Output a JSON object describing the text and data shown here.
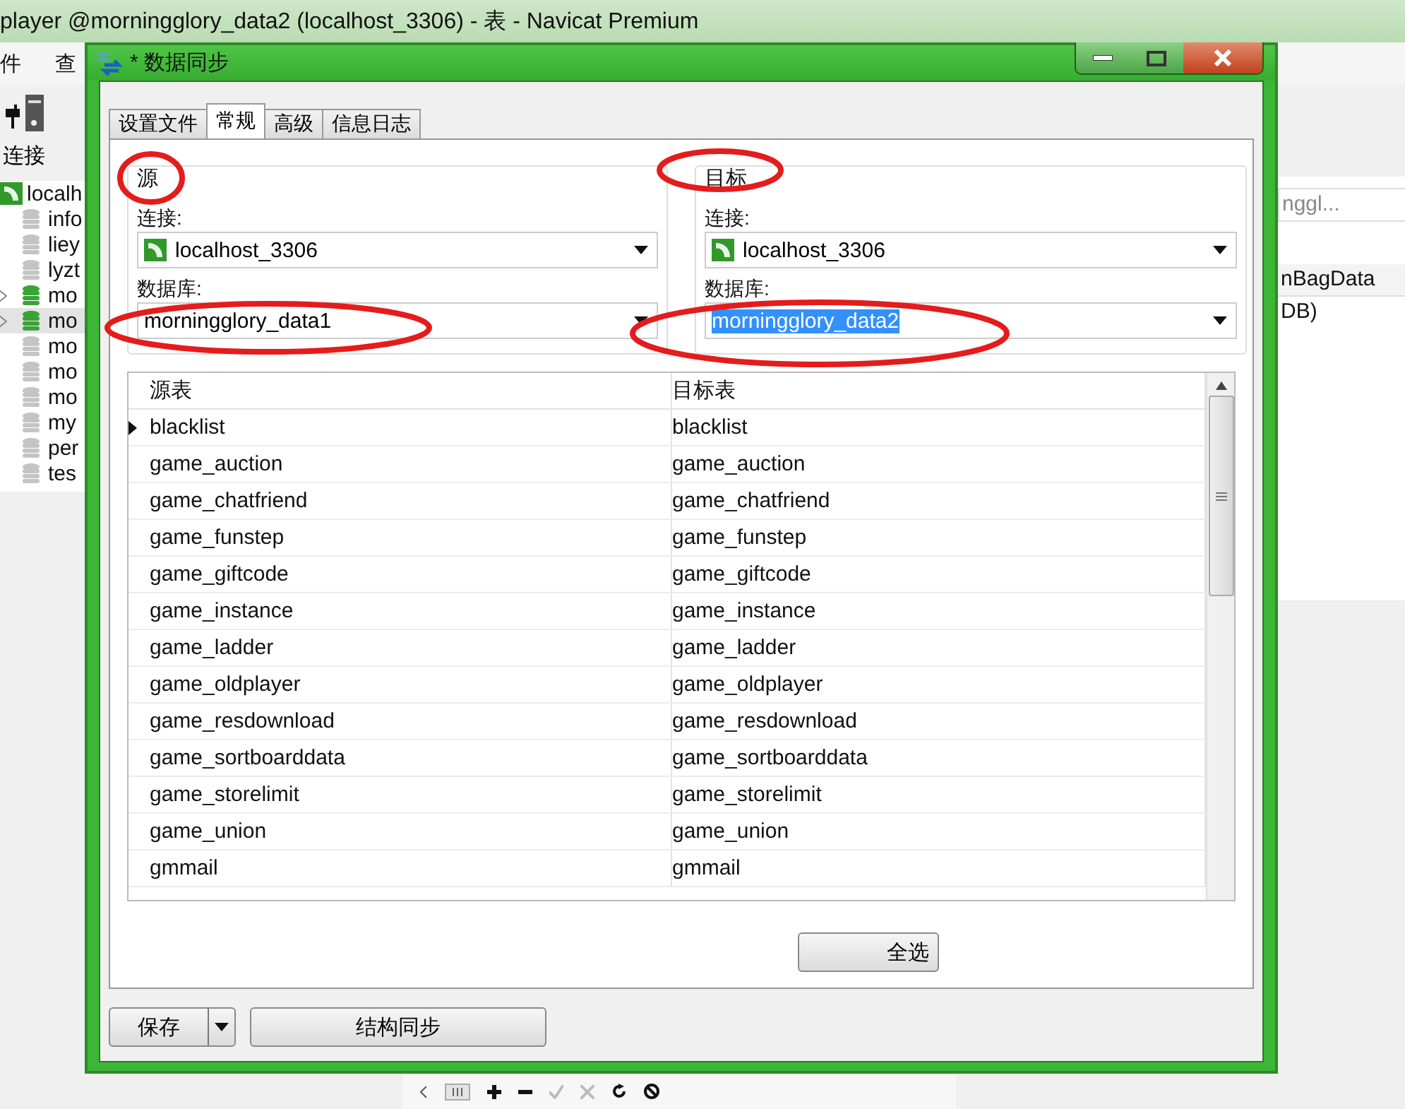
{
  "app": {
    "title": "player @morningglory_data2 (localhost_3306) - 表 - Navicat Premium",
    "menu": [
      "件",
      "查"
    ],
    "toolbar": {
      "label": "连接"
    },
    "tree": {
      "label": "localh",
      "children": [
        {
          "label": "info",
          "active": false,
          "expandable": false,
          "selected": false
        },
        {
          "label": "liey",
          "active": false,
          "expandable": false,
          "selected": false
        },
        {
          "label": "lyzt",
          "active": false,
          "expandable": false,
          "selected": false
        },
        {
          "label": "mo",
          "active": true,
          "expandable": true,
          "selected": false
        },
        {
          "label": "mo",
          "active": true,
          "expandable": true,
          "selected": true
        },
        {
          "label": "mo",
          "active": false,
          "expandable": false,
          "selected": false
        },
        {
          "label": "mo",
          "active": false,
          "expandable": false,
          "selected": false
        },
        {
          "label": "mo",
          "active": false,
          "expandable": false,
          "selected": false
        },
        {
          "label": "my",
          "active": false,
          "expandable": false,
          "selected": false
        },
        {
          "label": "per",
          "active": false,
          "expandable": false,
          "selected": false
        },
        {
          "label": "tes",
          "active": false,
          "expandable": false,
          "selected": false
        }
      ]
    },
    "search": {
      "placeholder": "nggl..."
    },
    "column": "nBagData",
    "cell": "DB)"
  },
  "dialog": {
    "title": "* 数据同步",
    "tabs": [
      {
        "label": "设置文件",
        "selected": false
      },
      {
        "label": "常规",
        "selected": true
      },
      {
        "label": "高级",
        "selected": false
      },
      {
        "label": "信息日志",
        "selected": false
      }
    ],
    "groups": [
      {
        "title": "源",
        "connection_label": "连接:",
        "connection": "localhost_3306",
        "database_label": "数据库:",
        "database": "morningglory_data1",
        "database_selected": false
      },
      {
        "title": "目标",
        "connection_label": "连接:",
        "connection": "localhost_3306",
        "database_label": "数据库:",
        "database": "morningglory_data2",
        "database_selected": true
      }
    ],
    "table": {
      "columns": [
        "源表",
        "目标表"
      ],
      "rows": [
        {
          "source": "blacklist",
          "target": "blacklist",
          "current": true
        },
        {
          "source": "game_auction",
          "target": "game_auction",
          "current": false
        },
        {
          "source": "game_chatfriend",
          "target": "game_chatfriend",
          "current": false
        },
        {
          "source": "game_funstep",
          "target": "game_funstep",
          "current": false
        },
        {
          "source": "game_giftcode",
          "target": "game_giftcode",
          "current": false
        },
        {
          "source": "game_instance",
          "target": "game_instance",
          "current": false
        },
        {
          "source": "game_ladder",
          "target": "game_ladder",
          "current": false
        },
        {
          "source": "game_oldplayer",
          "target": "game_oldplayer",
          "current": false
        },
        {
          "source": "game_resdownload",
          "target": "game_resdownload",
          "current": false
        },
        {
          "source": "game_sortboarddata",
          "target": "game_sortboarddata",
          "current": false
        },
        {
          "source": "game_storelimit",
          "target": "game_storelimit",
          "current": false
        },
        {
          "source": "game_union",
          "target": "game_union",
          "current": false
        },
        {
          "source": "gmmail",
          "target": "gmmail",
          "current": false
        }
      ]
    },
    "select_all": "全选",
    "save": "保存",
    "structure_sync": "结构同步"
  }
}
